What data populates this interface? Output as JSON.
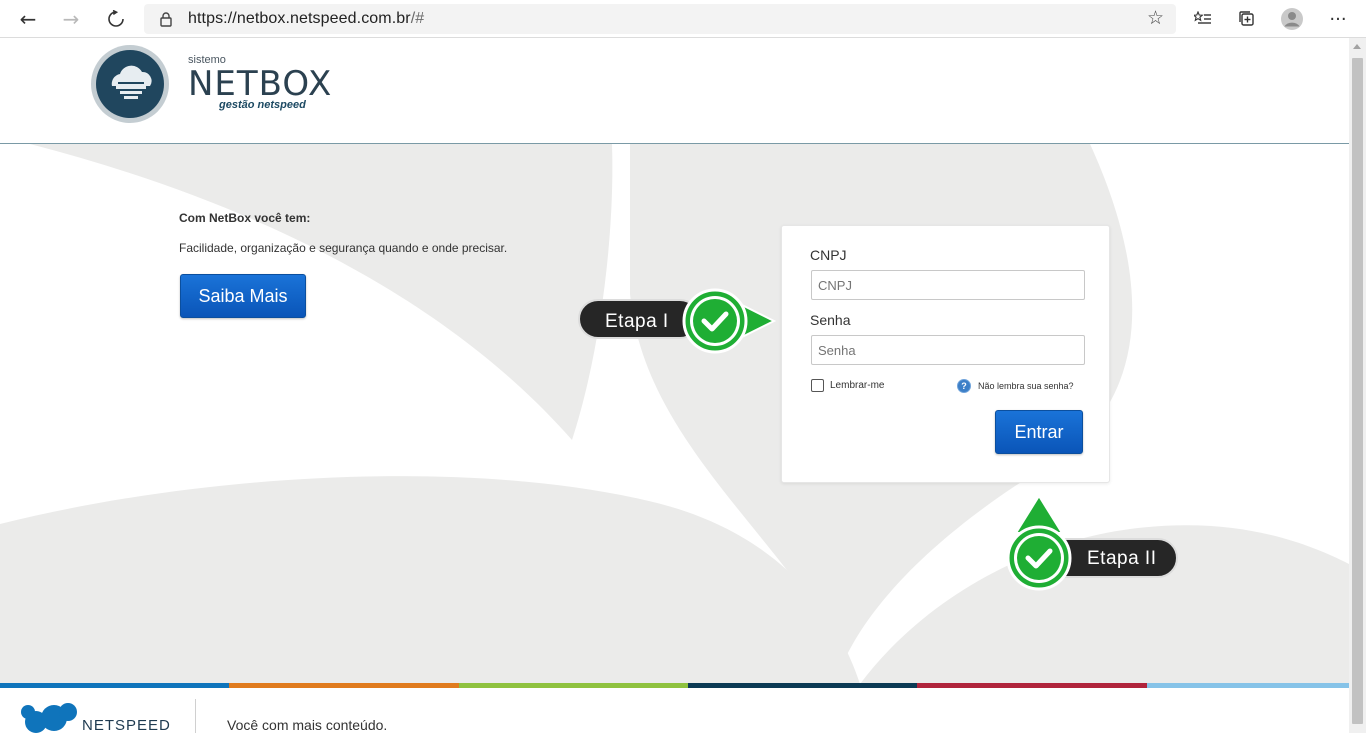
{
  "browser": {
    "url_host": "https://netbox.netspeed.com.br",
    "url_path": "/#"
  },
  "header": {
    "brand_small": "sistemo",
    "brand_name": "NETBOX",
    "brand_sub": "gestão netspeed"
  },
  "intro": {
    "title": "Com NetBox você tem:",
    "text": "Facilidade, organização e segurança quando e onde precisar.",
    "button": "Saiba Mais"
  },
  "login": {
    "cnpj_label": "CNPJ",
    "cnpj_placeholder": "CNPJ",
    "senha_label": "Senha",
    "senha_placeholder": "Senha",
    "remember": "Lembrar-me",
    "forgot": "Não lembra sua senha?",
    "submit": "Entrar"
  },
  "callouts": {
    "step1": "Etapa I",
    "step2": "Etapa II"
  },
  "footer": {
    "brand": "NETSPEED",
    "tagline": "Você com mais conteúdo.",
    "stripe_colors": [
      "#0f74bb",
      "#e07b1e",
      "#8fc23f",
      "#0c3a54",
      "#b0243c",
      "#86c3e8"
    ]
  },
  "colors": {
    "primary_button": "#0a5fc4",
    "callout_green": "#1fae34",
    "callout_dark": "#262626"
  }
}
